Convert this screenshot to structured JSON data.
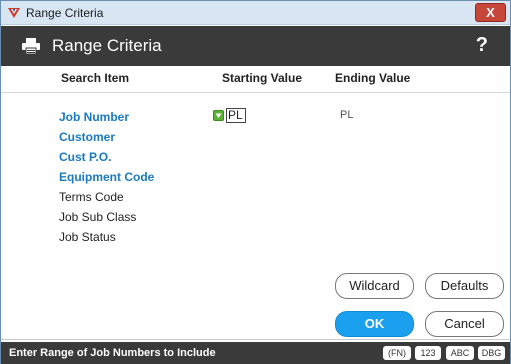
{
  "window": {
    "title": "Range Criteria",
    "close_label": "X"
  },
  "header": {
    "title": "Range Criteria",
    "help_label": "?"
  },
  "columns": {
    "search_item": "Search Item",
    "starting_value": "Starting Value",
    "ending_value": "Ending Value"
  },
  "search_items": [
    {
      "label": "Job Number",
      "active": true
    },
    {
      "label": "Customer",
      "active": true
    },
    {
      "label": "Cust P.O.",
      "active": true
    },
    {
      "label": "Equipment Code",
      "active": true
    },
    {
      "label": "Terms Code",
      "active": false
    },
    {
      "label": "Job Sub Class",
      "active": false
    },
    {
      "label": "Job Status",
      "active": false
    }
  ],
  "job_number_range": {
    "starting_value": "PL",
    "ending_value": "PL"
  },
  "buttons": {
    "wildcard": "Wildcard",
    "defaults": "Defaults",
    "ok": "OK",
    "cancel": "Cancel"
  },
  "status": {
    "message": "Enter Range of Job Numbers to Include",
    "pills": [
      "(FN)",
      "123",
      "ABC",
      "DBG"
    ]
  },
  "colors": {
    "header_bg": "#3a3a3a",
    "active_item": "#1a7ac0",
    "ok_button": "#1ba0f0",
    "close_button": "#c7463a"
  }
}
